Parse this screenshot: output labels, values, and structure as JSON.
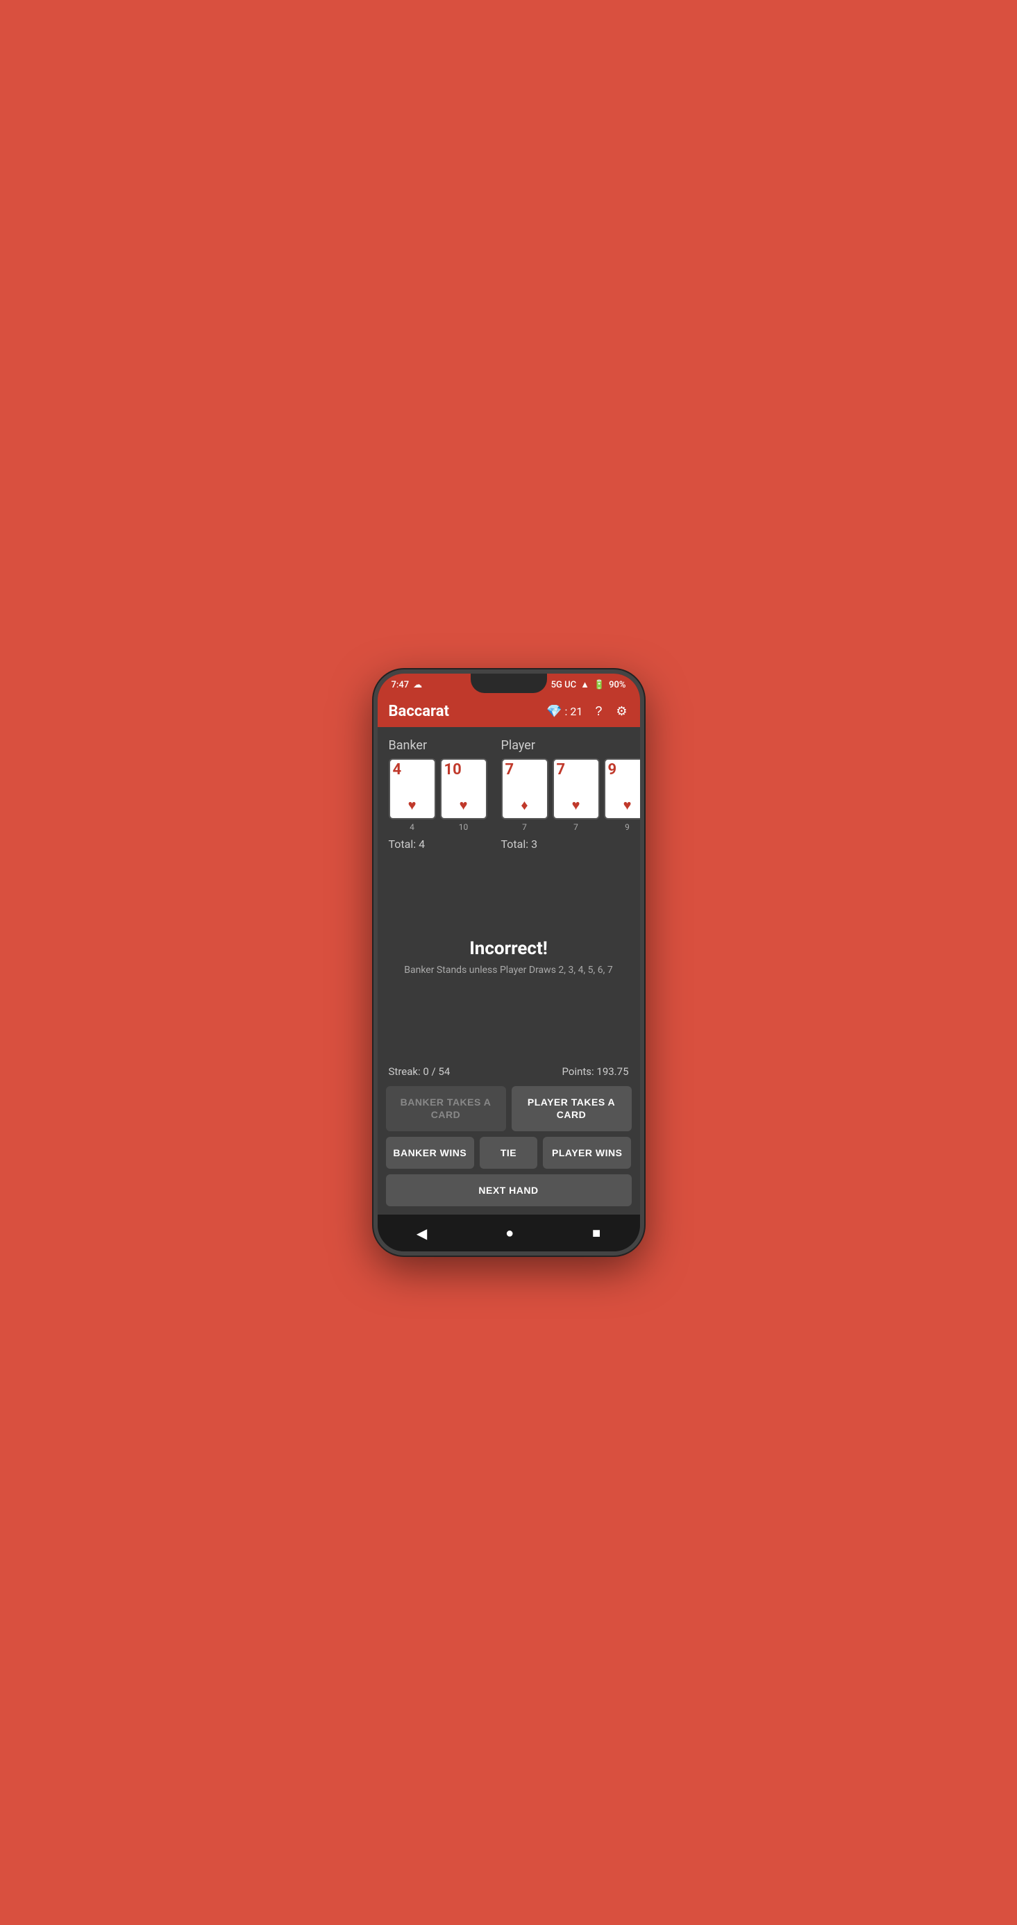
{
  "statusBar": {
    "time": "7:47",
    "network": "5G UC",
    "battery": "90%"
  },
  "toolbar": {
    "title": "Baccarat",
    "gems": "21"
  },
  "banker": {
    "label": "Banker",
    "cards": [
      {
        "value": "4",
        "suit": "♥",
        "label": "4"
      },
      {
        "value": "10",
        "suit": "♥",
        "label": "10"
      }
    ],
    "total": "Total: 4"
  },
  "player": {
    "label": "Player",
    "cards": [
      {
        "value": "7",
        "suit": "♦",
        "label": "7"
      },
      {
        "value": "7",
        "suit": "♥",
        "label": "7"
      },
      {
        "value": "9",
        "suit": "♥",
        "label": "9"
      }
    ],
    "total": "Total: 3"
  },
  "result": {
    "title": "Incorrect!",
    "subtitle": "Banker Stands unless Player Draws 2, 3, 4, 5, 6, 7"
  },
  "stats": {
    "streak": "Streak: 0 / 54",
    "points": "Points: 193.75"
  },
  "buttons": {
    "bankerTakesCard": "BANKER TAKES A CARD",
    "playerTakesCard": "PLAYER TAKES A CARD",
    "bankerWins": "BANKER WINS",
    "tie": "TIE",
    "playerWins": "PLAYER WINS",
    "nextHand": "NEXT HAND"
  },
  "nav": {
    "back": "◀",
    "home": "●",
    "recent": "■"
  }
}
